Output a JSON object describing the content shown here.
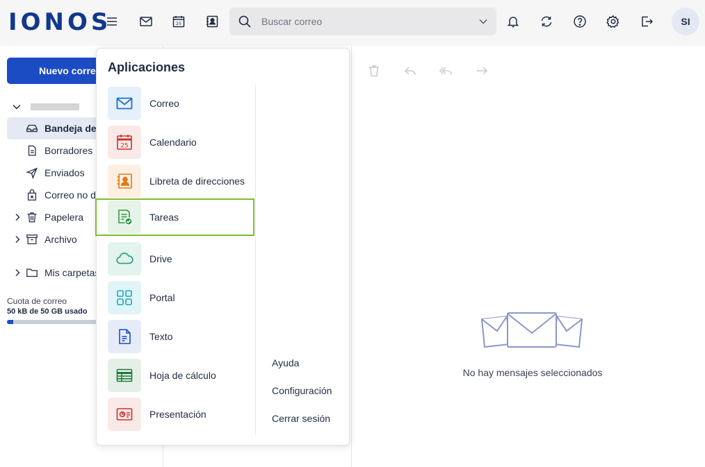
{
  "header": {
    "logo": "IONOS",
    "icons": [
      "menu-icon",
      "mail-icon",
      "calendar-icon",
      "contacts-icon"
    ],
    "search": {
      "placeholder": "Buscar correo"
    },
    "right_icons": [
      "bell-icon",
      "refresh-icon",
      "help-icon",
      "gear-icon",
      "logout-icon"
    ],
    "avatar_initials": "SI"
  },
  "sidebar": {
    "new_mail_label": "Nuevo correo",
    "folders": [
      {
        "label": "Bandeja de entrada",
        "icon": "inbox-icon",
        "active": true
      },
      {
        "label": "Borradores",
        "icon": "draft-icon"
      },
      {
        "label": "Enviados",
        "icon": "send-icon"
      },
      {
        "label": "Correo no deseado",
        "icon": "spam-icon"
      },
      {
        "label": "Papelera",
        "icon": "trash-icon",
        "expandable": true
      },
      {
        "label": "Archivo",
        "icon": "archive-icon",
        "expandable": true
      },
      {
        "label": "Mis carpetas",
        "icon": "folder-icon",
        "expandable": true
      }
    ],
    "quota": {
      "label": "Cuota de correo",
      "value": "50 kB de 50 GB usado",
      "fraction": 0.001
    }
  },
  "message_view": {
    "empty_text": "No hay mensajes seleccionados"
  },
  "launcher": {
    "title": "Aplicaciones",
    "apps": [
      {
        "label": "Correo",
        "icon": "mail-icon",
        "color": "#1b6fd1",
        "bg": "#e6f0fb"
      },
      {
        "label": "Calendario",
        "icon": "calendar-icon",
        "color": "#c8342e",
        "bg": "#fbe9e8"
      },
      {
        "label": "Libreta de direcciones",
        "icon": "contacts-icon",
        "color": "#e07b18",
        "bg": "#fdf0e2"
      },
      {
        "label": "Tareas",
        "icon": "tasks-icon",
        "color": "#2f9a45",
        "bg": "#e6f3e8",
        "selected": true
      },
      {
        "label": "Drive",
        "icon": "cloud-icon",
        "color": "#1f9d7a",
        "bg": "#e3f3ee"
      },
      {
        "label": "Portal",
        "icon": "grid-icon",
        "color": "#1aa6c4",
        "bg": "#e1f4f8"
      },
      {
        "label": "Texto",
        "icon": "document-icon",
        "color": "#1b4cc4",
        "bg": "#e6ecf7"
      },
      {
        "label": "Hoja de cálculo",
        "icon": "spreadsheet-icon",
        "color": "#1e7a3c",
        "bg": "#e4f0e7"
      },
      {
        "label": "Presentación",
        "icon": "presentation-icon",
        "color": "#c8342e",
        "bg": "#fbe9e8"
      }
    ],
    "links": [
      "Ayuda",
      "Configuración",
      "Cerrar sesión"
    ]
  }
}
